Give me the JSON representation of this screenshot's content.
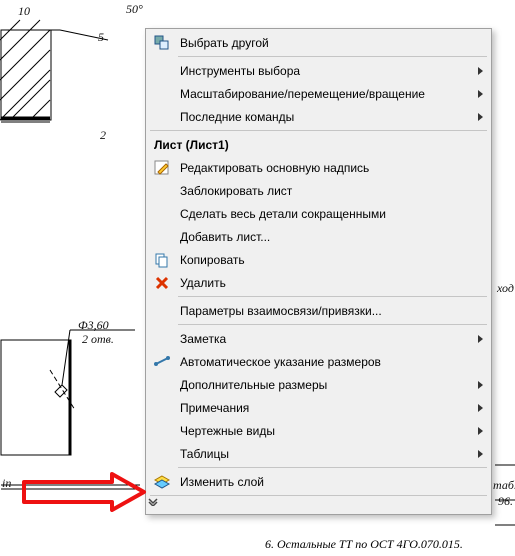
{
  "bg_labels": {
    "dim10": "10",
    "dim5": "5",
    "angle50": "50°",
    "dim2": "2",
    "phi360": "Ф3,60",
    "holes": "2 отв.",
    "in_text": "in",
    "right1": "ход",
    "right2": "таб.",
    "right3": "96."
  },
  "menu": {
    "select_other": "Выбрать другой",
    "selection_tools": "Инструменты выбора",
    "zoom_pan_rotate": "Масштабирование/перемещение/вращение",
    "recent_commands": "Последние команды",
    "header_sheet": "Лист (Лист1)",
    "edit_title_block": "Редактировать основную надпись",
    "lock_sheet": "Заблокировать лист",
    "make_abbrevs": "Сделать весь детали сокращенными",
    "add_sheet": "Добавить лист...",
    "copy": "Копировать",
    "delete": "Удалить",
    "relation_params": "Параметры взаимосвязи/привязки...",
    "annotations": "Заметка",
    "auto_dim": "Автоматическое указание размеров",
    "more_dims": "Дополнительные размеры",
    "notes": "Примечания",
    "drawing_views": "Чертежные виды",
    "tables": "Таблицы",
    "change_layer": "Изменить слой"
  },
  "footer": {
    "line_partial": "",
    "line_ost": "6. Остальные ТТ по ОСТ 4ГО.070.015."
  }
}
